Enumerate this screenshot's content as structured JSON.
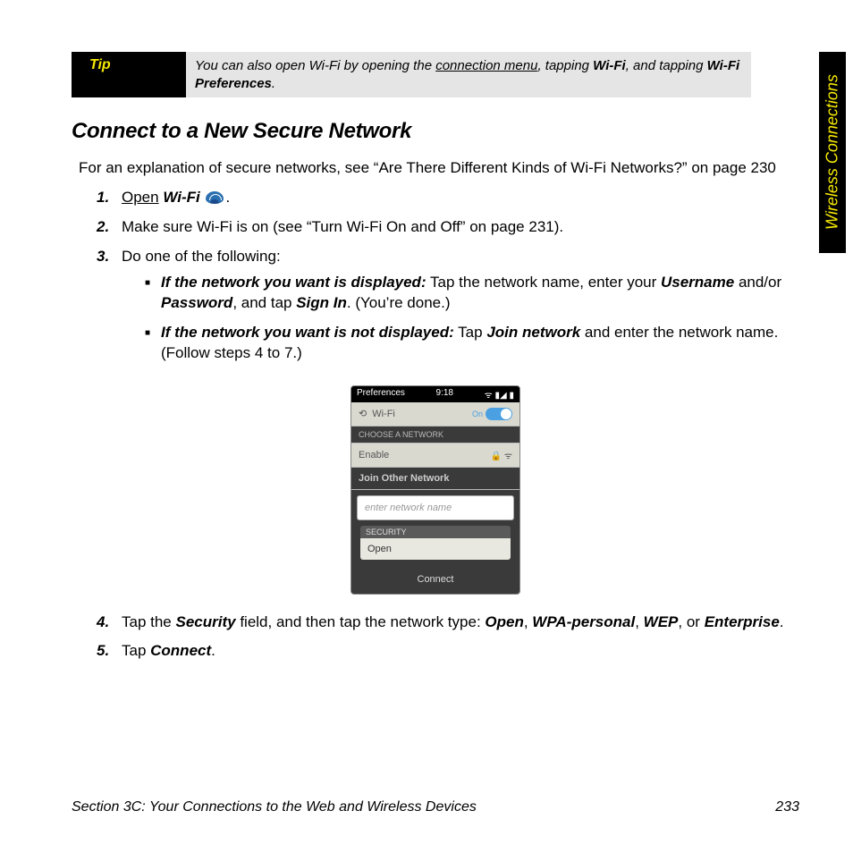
{
  "sideTab": "Wireless Connections",
  "tip": {
    "label": "Tip",
    "pre": "You can also open Wi-Fi by opening the ",
    "link": "connection menu",
    "mid": ", tapping ",
    "b1": "Wi-Fi",
    "mid2": ", and tapping ",
    "b2": "Wi-Fi Preferences",
    "post": "."
  },
  "heading": "Connect to a New Secure Network",
  "intro": "For an explanation of secure networks, see “Are There Different Kinds of Wi-Fi Networks?” on page 230",
  "steps": {
    "s1": {
      "num": "1.",
      "open": "Open",
      "app": "Wi-Fi",
      "end": "."
    },
    "s2": {
      "num": "2.",
      "text": "Make sure Wi-Fi is on (see “Turn Wi-Fi On and Off” on page 231)."
    },
    "s3": {
      "num": "3.",
      "lead": "Do one of the following:",
      "a": {
        "bold": "If the network you want is displayed:",
        "t1": " Tap the network name, enter your ",
        "i1": "Username",
        "t2": " and/or ",
        "i2": "Password",
        "t3": ", and tap ",
        "i3": "Sign In",
        "t4": ". (You’re done.)"
      },
      "b": {
        "bold": "If the network you want is not displayed:",
        "t1": " Tap ",
        "i1": "Join network",
        "t2": " and enter the network name. (Follow steps 4 to 7.)"
      }
    },
    "s4": {
      "num": "4.",
      "t1": "Tap the ",
      "i1": "Security",
      "t2": " field, and then tap the network type: ",
      "o1": "Open",
      "c1": ", ",
      "o2": "WPA-personal",
      "c2": ", ",
      "o3": "WEP",
      "c3": ", or ",
      "o4": "Enterprise",
      "end": "."
    },
    "s5": {
      "num": "5.",
      "t1": "Tap ",
      "i1": "Connect",
      "end": "."
    }
  },
  "phone": {
    "statusLeft": "Preferences",
    "time": "9:18",
    "wifiLabel": "Wi-Fi",
    "toggle": "On",
    "choose": "CHOOSE A NETWORK",
    "enable": "Enable",
    "joinTitle": "Join Other Network",
    "placeholder": "enter network name",
    "secLabel": "SECURITY",
    "secValue": "Open",
    "connect": "Connect"
  },
  "footer": {
    "left": "Section 3C: Your Connections to the Web and Wireless Devices",
    "right": "233"
  }
}
